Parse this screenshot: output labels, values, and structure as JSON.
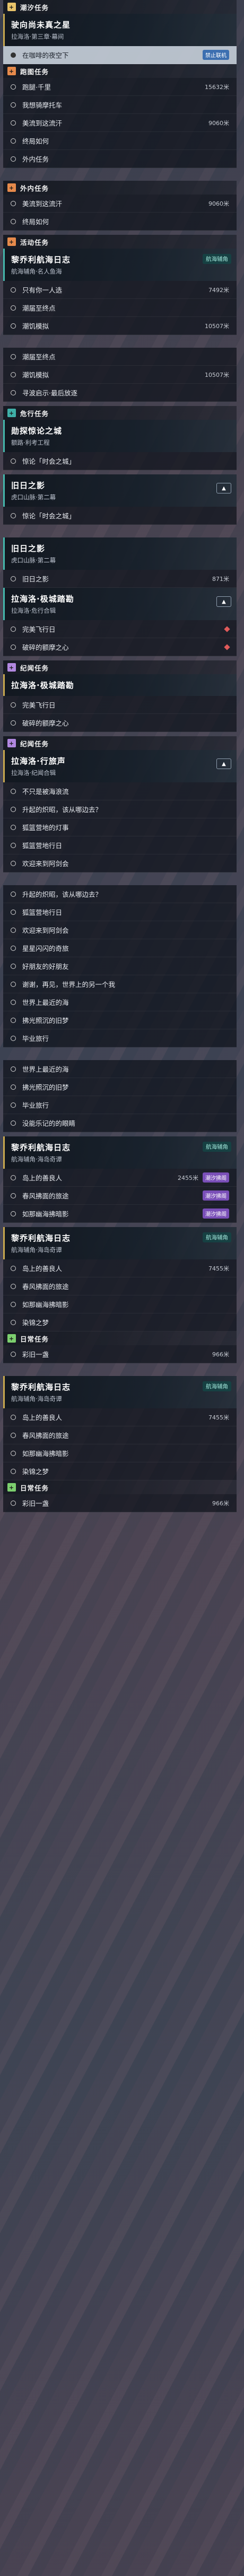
{
  "s1": {
    "header": "潮汐任务",
    "card_title": "驶向尚未真之星",
    "card_sub": "拉海洛·第三章·幕间",
    "active_row": "在咖啡的夜空下",
    "active_tag": "禁止联机"
  },
  "s2": {
    "header": "跑图任务",
    "rows": [
      "跑腿·千里",
      "我想骑摩托车",
      "美流到这流汗",
      "终局如何",
      "外内任务"
    ],
    "dists": [
      "15632米",
      "",
      "9060米",
      "",
      ""
    ]
  },
  "s3": {
    "header": "外内任务",
    "rows": [
      "美流到这流汗",
      "终局如何"
    ],
    "dists": [
      "9060米",
      ""
    ]
  },
  "s4": {
    "header": "活动任务",
    "card_title": "黎乔利航海日志",
    "card_sub": "航海辅角·名人鱼海",
    "card_tag": "航海辅角",
    "rows": [
      "只有你一人选",
      "潮届至终点",
      "潮饥模拟"
    ],
    "dists": [
      "7492米",
      "",
      "10507米"
    ]
  },
  "s5": {
    "rows": [
      "潮届至终点",
      "潮饥模拟",
      "寻波启示·最后放逐"
    ],
    "dists": [
      "",
      "10507米",
      ""
    ]
  },
  "s6": {
    "header": "危行任务",
    "card_title": "勋探惊论之城",
    "card_sub": "额路·利考工程",
    "rows": [
      "惊论「时会之城」"
    ]
  },
  "s7": {
    "card_title": "旧日之影",
    "card_sub": "虎口山脉·第二幕",
    "rows": [
      "惊论「时会之城」"
    ]
  },
  "s8": {
    "card_title": "旧日之影",
    "card_sub": "虎口山脉·第二幕",
    "rows": [
      "旧日之影"
    ],
    "dists": [
      "871米"
    ]
  },
  "s9": {
    "card_title": "拉海洛·极城踏勘",
    "card_sub": "拉海洛·危行合辑",
    "rows": [
      "完美飞行日",
      "破碎的额摩之心"
    ]
  },
  "s10": {
    "header": "纪闻任务",
    "card_title": "拉海洛·极城踏勘",
    "rows": [
      "完美飞行日",
      "破碎的额摩之心"
    ]
  },
  "s11": {
    "header": "纪闻任务",
    "card_title": "拉海洛·行旅声",
    "card_sub": "拉海洛·纪闻合辑",
    "rows": [
      "不只是被海浪流",
      "升起的炽昭，该从哪边去？",
      "狐篮营地的灯事",
      "狐篮营地行日",
      "欢迎来到阿剑会"
    ]
  },
  "s12": {
    "rows": [
      "升起的炽昭，该从哪边去？",
      "狐篮营地行日",
      "欢迎来到阿剑会",
      "星星闪闪的奇旅",
      "好朋友的好朋友",
      "谢谢，再见，世界上的另一个我",
      "世界上最近的海",
      "拂光照沉的旧梦",
      "毕业旅行"
    ]
  },
  "s13": {
    "rows": [
      "世界上最近的海",
      "拂光照沉的旧梦",
      "毕业旅行",
      "没能乐记的的眼睛"
    ]
  },
  "s14": {
    "card_title": "黎乔利航海日志",
    "card_sub": "航海辅角·海岛奇谭",
    "card_tag": "航海辅角",
    "rows": [
      "岛上的善良人",
      "春风拂面的旅途",
      "如那幽海拂暗影"
    ],
    "dists": [
      "2455米",
      "",
      ""
    ],
    "badges": [
      "潮汐拂阁",
      "潮汐拂阁",
      "潮汐拂阁"
    ]
  },
  "s15": {
    "card_title": "黎乔利航海日志",
    "card_sub": "航海辅角·海岛奇谭",
    "card_tag": "航海辅角",
    "rows": [
      "岛上的善良人",
      "春风拂面的旅途",
      "如那幽海拂暗影",
      "染锦之梦"
    ],
    "dists": [
      "7455米",
      "",
      "",
      ""
    ]
  },
  "s16": {
    "header": "日常任务",
    "rows": [
      "彩旧一盏"
    ],
    "dists": [
      "966米"
    ]
  },
  "s17": {
    "card_title": "黎乔利航海日志",
    "card_sub": "航海辅角·海岛奇谭",
    "card_tag": "航海辅角",
    "rows": [
      "岛上的善良人",
      "春风拂面的旅途",
      "如那幽海拂暗影",
      "染锦之梦"
    ],
    "dists": [
      "7455米",
      "",
      "",
      ""
    ]
  },
  "s18": {
    "header": "日常任务",
    "rows": [
      "彩旧一盏"
    ],
    "dists": [
      "966米"
    ]
  }
}
